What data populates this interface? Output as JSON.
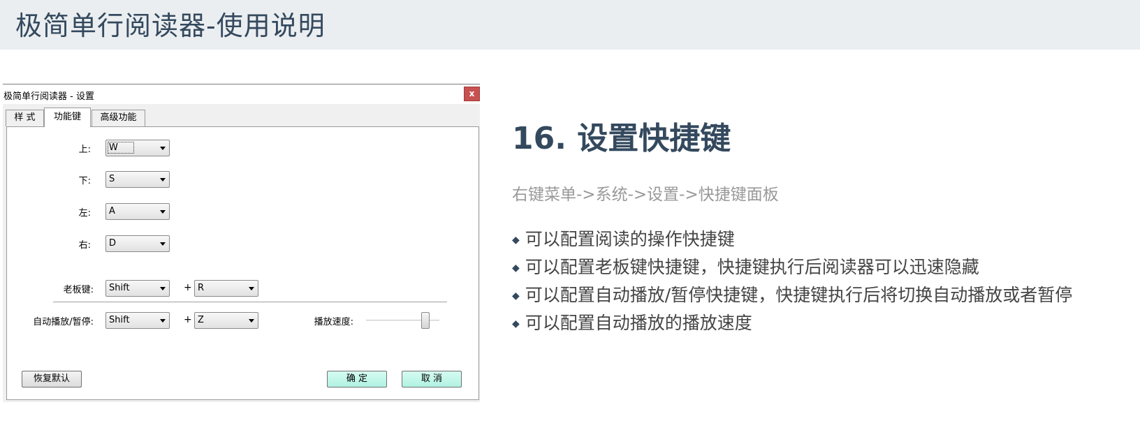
{
  "header": {
    "title": "极简单行阅读器-使用说明"
  },
  "dialog": {
    "title": "极简单行阅读器 - 设置",
    "close_label": "x",
    "tabs": [
      {
        "label": "样 式",
        "active": false
      },
      {
        "label": "功能键",
        "active": true
      },
      {
        "label": "高级功能",
        "active": false
      }
    ],
    "direction_keys": [
      {
        "label": "上:",
        "value": "W"
      },
      {
        "label": "下:",
        "value": "S"
      },
      {
        "label": "左:",
        "value": "A"
      },
      {
        "label": "右:",
        "value": "D"
      }
    ],
    "boss_key": {
      "label": "老板键:",
      "modifier": "Shift",
      "plus": "+",
      "key": "R"
    },
    "autoplay_key": {
      "label": "自动播放/暂停:",
      "modifier": "Shift",
      "plus": "+",
      "key": "Z"
    },
    "speed": {
      "label": "播放速度:",
      "level": 0.85
    },
    "buttons": {
      "restore": "恢复默认",
      "ok": "确 定",
      "cancel": "取 消"
    }
  },
  "section": {
    "title": "16. 设置快捷键",
    "path": "右键菜单->系统->设置->快捷键面板",
    "bullet_symbol": "◆",
    "bullets": [
      "可以配置阅读的操作快捷键",
      "可以配置老板键快捷键，快捷键执行后阅读器可以迅速隐藏",
      "可以配置自动播放/暂停快捷键，快捷键执行后将切换自动播放或者暂停",
      "可以配置自动播放的播放速度"
    ]
  },
  "colors": {
    "heading": "#34495e",
    "header_bg": "#ebeef0",
    "close_button": "#c75050",
    "primary_button": "#b0f2e2"
  }
}
